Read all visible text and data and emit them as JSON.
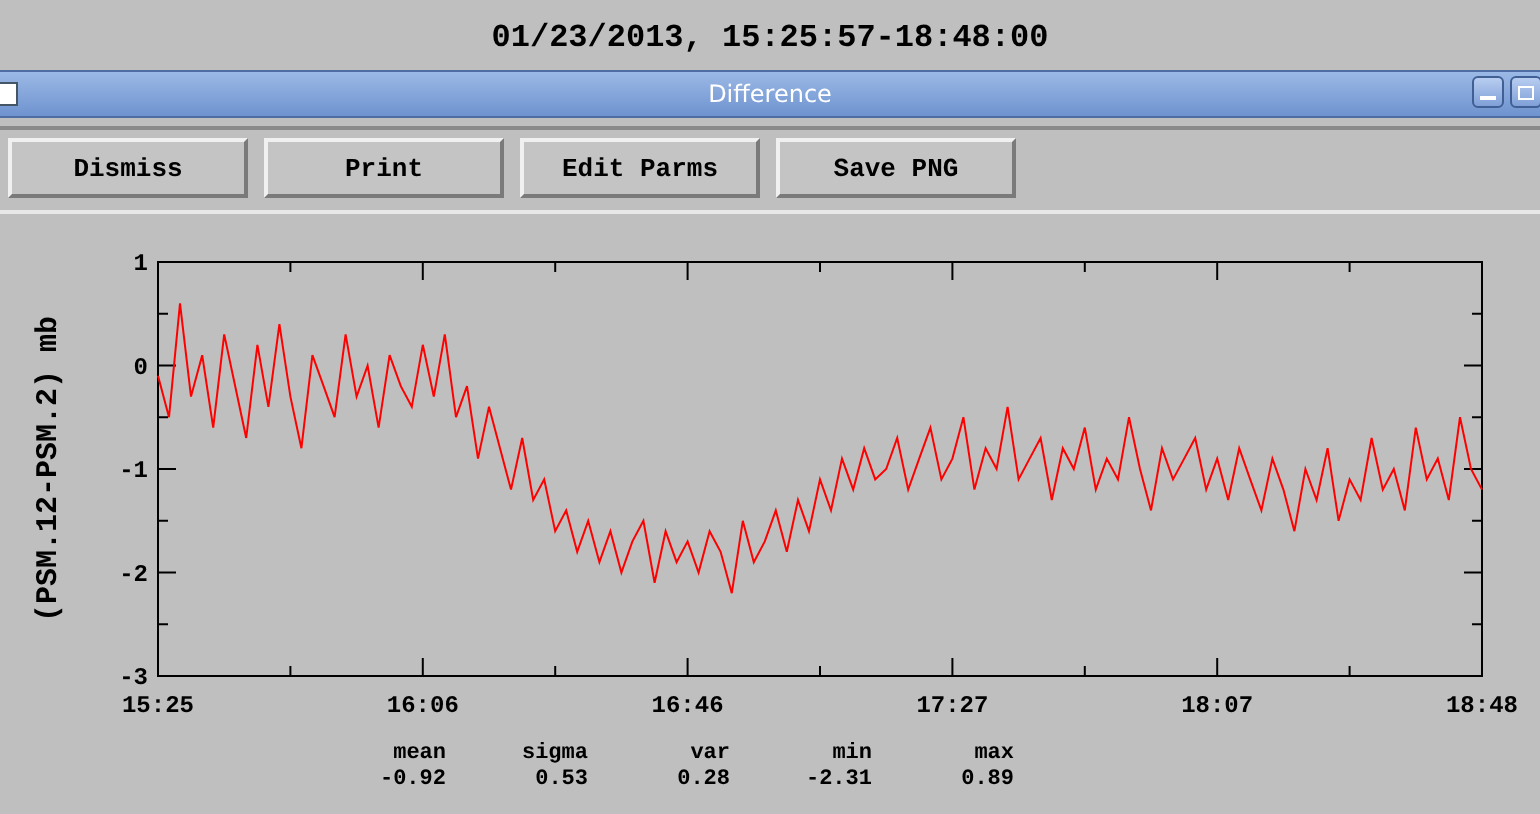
{
  "page_title": "01/23/2013, 15:25:57-18:48:00",
  "window": {
    "title": "Difference"
  },
  "buttons": [
    "Dismiss",
    "Print",
    "Edit Parms",
    "Save PNG"
  ],
  "plot": {
    "chart_data": {
      "type": "line",
      "ylabel": "(PSM.12-PSM.2) mb",
      "ylim": [
        -3,
        1
      ],
      "yticks": [
        1,
        0,
        -1,
        -2,
        -3
      ],
      "categories": [
        "15:25",
        null,
        null,
        null,
        null,
        null,
        null,
        null,
        null,
        null,
        null,
        null,
        null,
        null,
        null,
        null,
        null,
        null,
        null,
        null,
        null,
        null,
        null,
        null,
        "16:06",
        null,
        null,
        null,
        null,
        null,
        null,
        null,
        null,
        null,
        null,
        null,
        null,
        null,
        null,
        null,
        null,
        null,
        null,
        null,
        null,
        null,
        null,
        null,
        "16:46",
        null,
        null,
        null,
        null,
        null,
        null,
        null,
        null,
        null,
        null,
        null,
        null,
        null,
        null,
        null,
        null,
        null,
        null,
        null,
        null,
        null,
        null,
        null,
        "17:27",
        null,
        null,
        null,
        null,
        null,
        null,
        null,
        null,
        null,
        null,
        null,
        null,
        null,
        null,
        null,
        null,
        null,
        null,
        null,
        null,
        null,
        null,
        null,
        "18:07",
        null,
        null,
        null,
        null,
        null,
        null,
        null,
        null,
        null,
        null,
        null,
        null,
        null,
        null,
        null,
        null,
        null,
        null,
        null,
        null,
        null,
        null,
        null,
        "18:48"
      ],
      "series": [
        {
          "color": "#ff0000",
          "values": [
            -0.1,
            -0.5,
            0.6,
            -0.3,
            0.1,
            -0.6,
            0.3,
            -0.2,
            -0.7,
            0.2,
            -0.4,
            0.4,
            -0.3,
            -0.8,
            0.1,
            -0.2,
            -0.5,
            0.3,
            -0.3,
            0.0,
            -0.6,
            0.1,
            -0.2,
            -0.4,
            0.2,
            -0.3,
            0.3,
            -0.5,
            -0.2,
            -0.9,
            -0.4,
            -0.8,
            -1.2,
            -0.7,
            -1.3,
            -1.1,
            -1.6,
            -1.4,
            -1.8,
            -1.5,
            -1.9,
            -1.6,
            -2.0,
            -1.7,
            -1.5,
            -2.1,
            -1.6,
            -1.9,
            -1.7,
            -2.0,
            -1.6,
            -1.8,
            -2.2,
            -1.5,
            -1.9,
            -1.7,
            -1.4,
            -1.8,
            -1.3,
            -1.6,
            -1.1,
            -1.4,
            -0.9,
            -1.2,
            -0.8,
            -1.1,
            -1.0,
            -0.7,
            -1.2,
            -0.9,
            -0.6,
            -1.1,
            -0.9,
            -0.5,
            -1.2,
            -0.8,
            -1.0,
            -0.4,
            -1.1,
            -0.9,
            -0.7,
            -1.3,
            -0.8,
            -1.0,
            -0.6,
            -1.2,
            -0.9,
            -1.1,
            -0.5,
            -1.0,
            -1.4,
            -0.8,
            -1.1,
            -0.9,
            -0.7,
            -1.2,
            -0.9,
            -1.3,
            -0.8,
            -1.1,
            -1.4,
            -0.9,
            -1.2,
            -1.6,
            -1.0,
            -1.3,
            -0.8,
            -1.5,
            -1.1,
            -1.3,
            -0.7,
            -1.2,
            -1.0,
            -1.4,
            -0.6,
            -1.1,
            -0.9,
            -1.3,
            -0.5,
            -1.0,
            -1.2
          ]
        }
      ]
    }
  },
  "stats": [
    {
      "label": "mean",
      "value": "-0.92"
    },
    {
      "label": "sigma",
      "value": "0.53"
    },
    {
      "label": "var",
      "value": "0.28"
    },
    {
      "label": "min",
      "value": "-2.31"
    },
    {
      "label": "max",
      "value": "0.89"
    }
  ]
}
